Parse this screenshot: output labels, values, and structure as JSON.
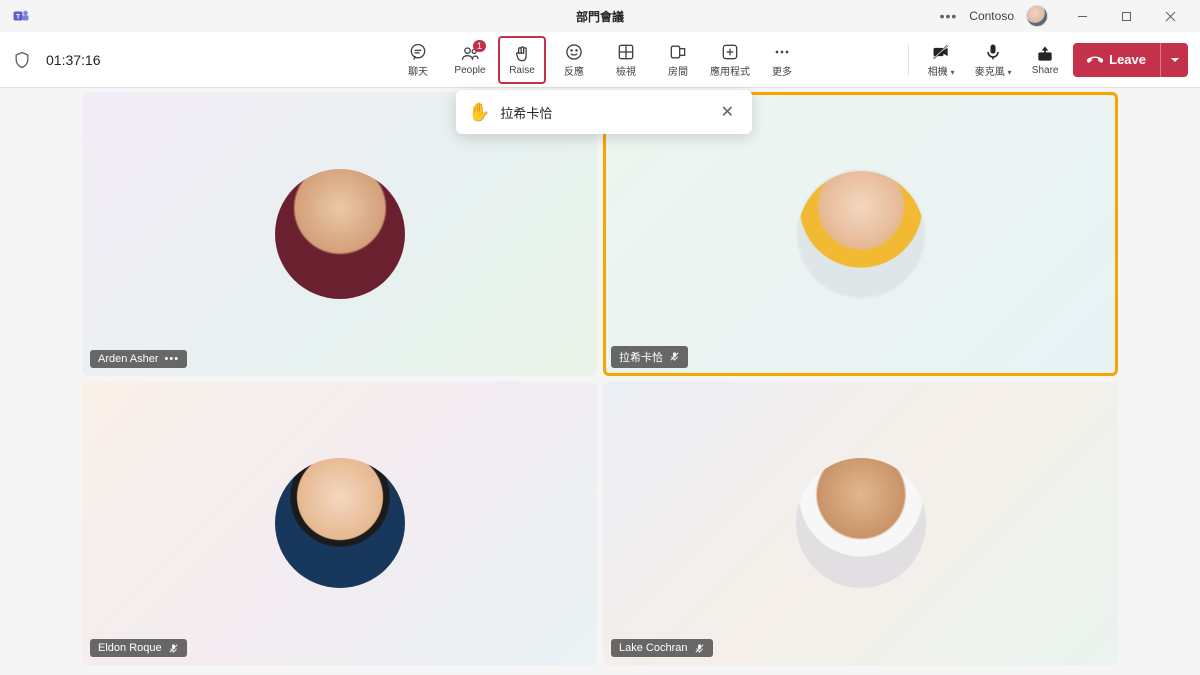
{
  "titlebar": {
    "title": "部門會議",
    "org": "Contoso"
  },
  "toolbar": {
    "timer": "01:37:16",
    "chat": "聊天",
    "people": "People",
    "people_badge": "1",
    "raise": "Raise",
    "react": "反應",
    "view": "檢視",
    "rooms": "房間",
    "apps": "應用程式",
    "more": "更多",
    "camera": "相機",
    "mic": "麥克風",
    "share": "Share",
    "leave": "Leave"
  },
  "toast": {
    "name": "拉希卡恰"
  },
  "participants": [
    {
      "name": "Arden Asher",
      "muted": false,
      "more": true,
      "raised": false
    },
    {
      "name": "拉希卡恰",
      "muted": true,
      "more": false,
      "raised": true
    },
    {
      "name": "Eldon Roque",
      "muted": true,
      "more": false,
      "raised": false
    },
    {
      "name": "Lake Cochran",
      "muted": true,
      "more": false,
      "raised": false
    }
  ]
}
